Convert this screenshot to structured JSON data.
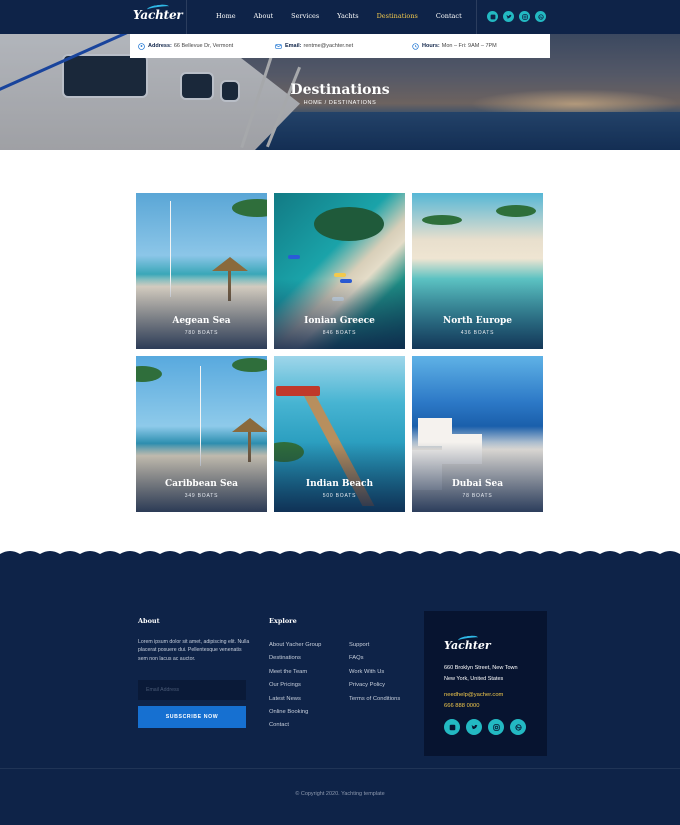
{
  "brand": {
    "name": "Yachter"
  },
  "nav": {
    "items": [
      {
        "label": "Home",
        "active": false
      },
      {
        "label": "About",
        "active": false
      },
      {
        "label": "Services",
        "active": false
      },
      {
        "label": "Yachts",
        "active": false
      },
      {
        "label": "Destinations",
        "active": true
      },
      {
        "label": "Contact",
        "active": false
      }
    ],
    "socials": [
      "facebook-icon",
      "twitter-icon",
      "instagram-icon",
      "dribbble-icon"
    ]
  },
  "infobar": {
    "address_label": "Address:",
    "address_value": "66 Bellevue Dr, Vermont",
    "email_label": "Email:",
    "email_value": "rentme@yachter.net",
    "hours_label": "Hours:",
    "hours_value": "Mon – Fri: 9AM – 7PM"
  },
  "hero": {
    "title": "Destinations",
    "breadcrumb": "HOME / DESTINATIONS"
  },
  "destinations": [
    {
      "name": "Aegean Sea",
      "boats": "780 BOATS"
    },
    {
      "name": "Ionian Greece",
      "boats": "846 BOATS"
    },
    {
      "name": "North Europe",
      "boats": "436 BOATS"
    },
    {
      "name": "Caribbean Sea",
      "boats": "349 BOATS"
    },
    {
      "name": "Indian Beach",
      "boats": "500 BOATS"
    },
    {
      "name": "Dubai Sea",
      "boats": "78 BOATS"
    }
  ],
  "footer": {
    "about_title": "About",
    "about_text": "Lorem ipsum dolor sit amet, adipiscing elit. Nulla placerat posuere dui. Pellentesque venenatis sem non lacus ac auctor.",
    "email_placeholder": "Email Address",
    "subscribe_label": "SUBSCRIBE NOW",
    "explore_title": "Explore",
    "explore_col1": [
      "About Yacher Group",
      "Destinations",
      "Meet the Team",
      "Our Pricings",
      "Latest News",
      "Online Booking",
      "Contact"
    ],
    "explore_col2": [
      "Support",
      "FAQs",
      "Work With Us",
      "Privacy Policy",
      "Terms of Conditions"
    ],
    "contact": {
      "address_line1": "660 Broklyn Street, New Town",
      "address_line2": "New York, United States",
      "email": "needhelp@yacher.com",
      "phone": "666 888 0000"
    },
    "copyright": "© Copyright 2020. Yachting template"
  },
  "colors": {
    "navy": "#0e2348",
    "accent_yellow": "#f2c94c",
    "teal": "#23b9c2",
    "button_blue": "#1670d1"
  }
}
